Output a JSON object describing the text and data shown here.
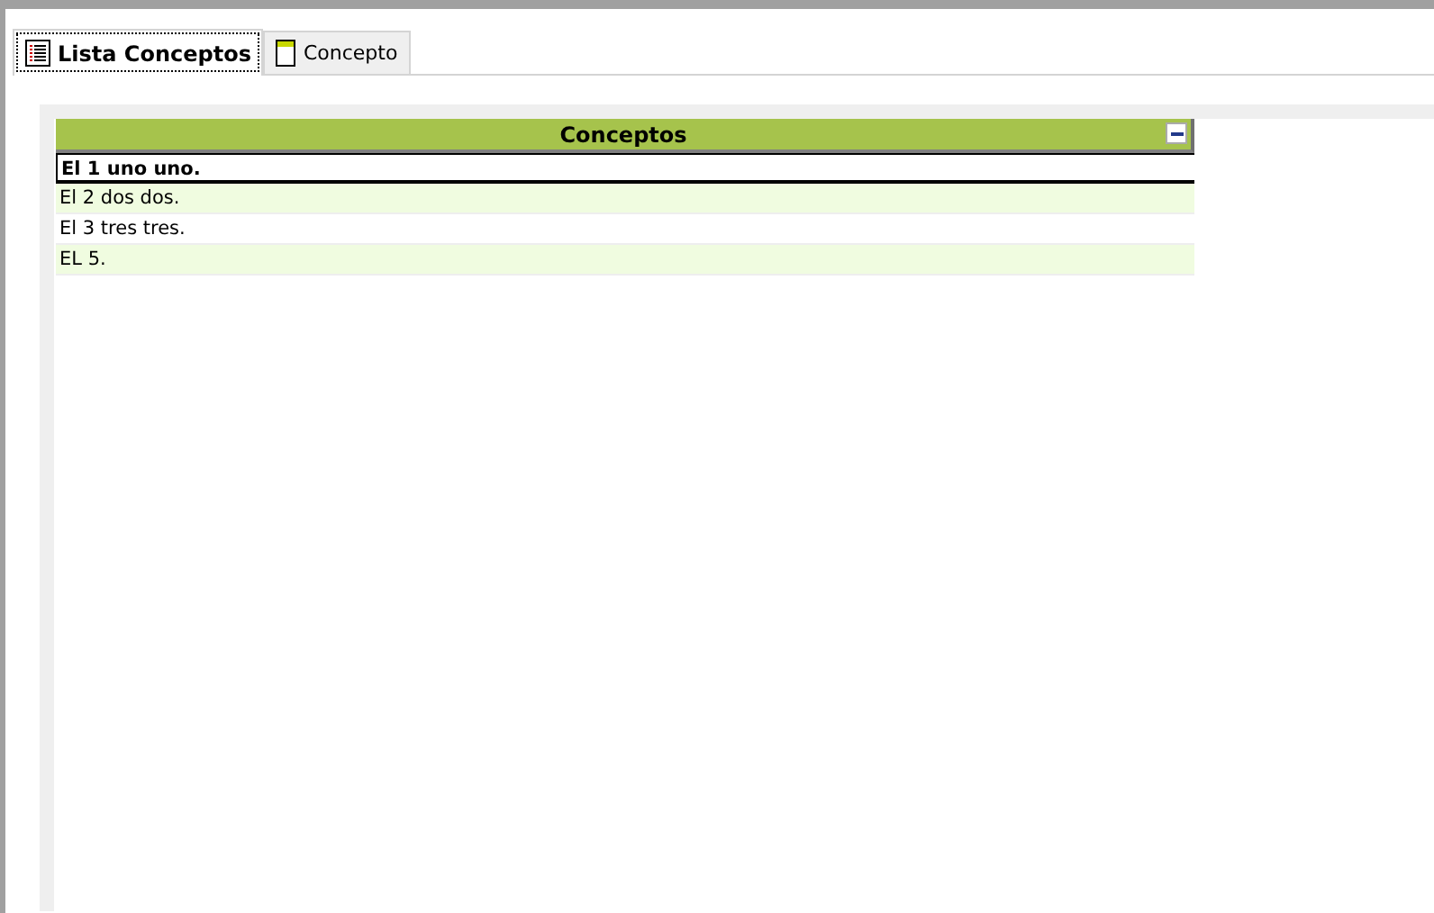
{
  "tabs": [
    {
      "label": "Lista Conceptos",
      "kind": "list",
      "selected": true
    },
    {
      "label": "Concepto",
      "kind": "form",
      "selected": false
    }
  ],
  "grid": {
    "column": "Conceptos",
    "rows": [
      {
        "text": "El 1 uno uno.",
        "selected": true
      },
      {
        "text": "El 2 dos dos.",
        "selected": false
      },
      {
        "text": "El 3 tres tres.",
        "selected": false
      },
      {
        "text": "EL 5.",
        "selected": false
      }
    ]
  }
}
